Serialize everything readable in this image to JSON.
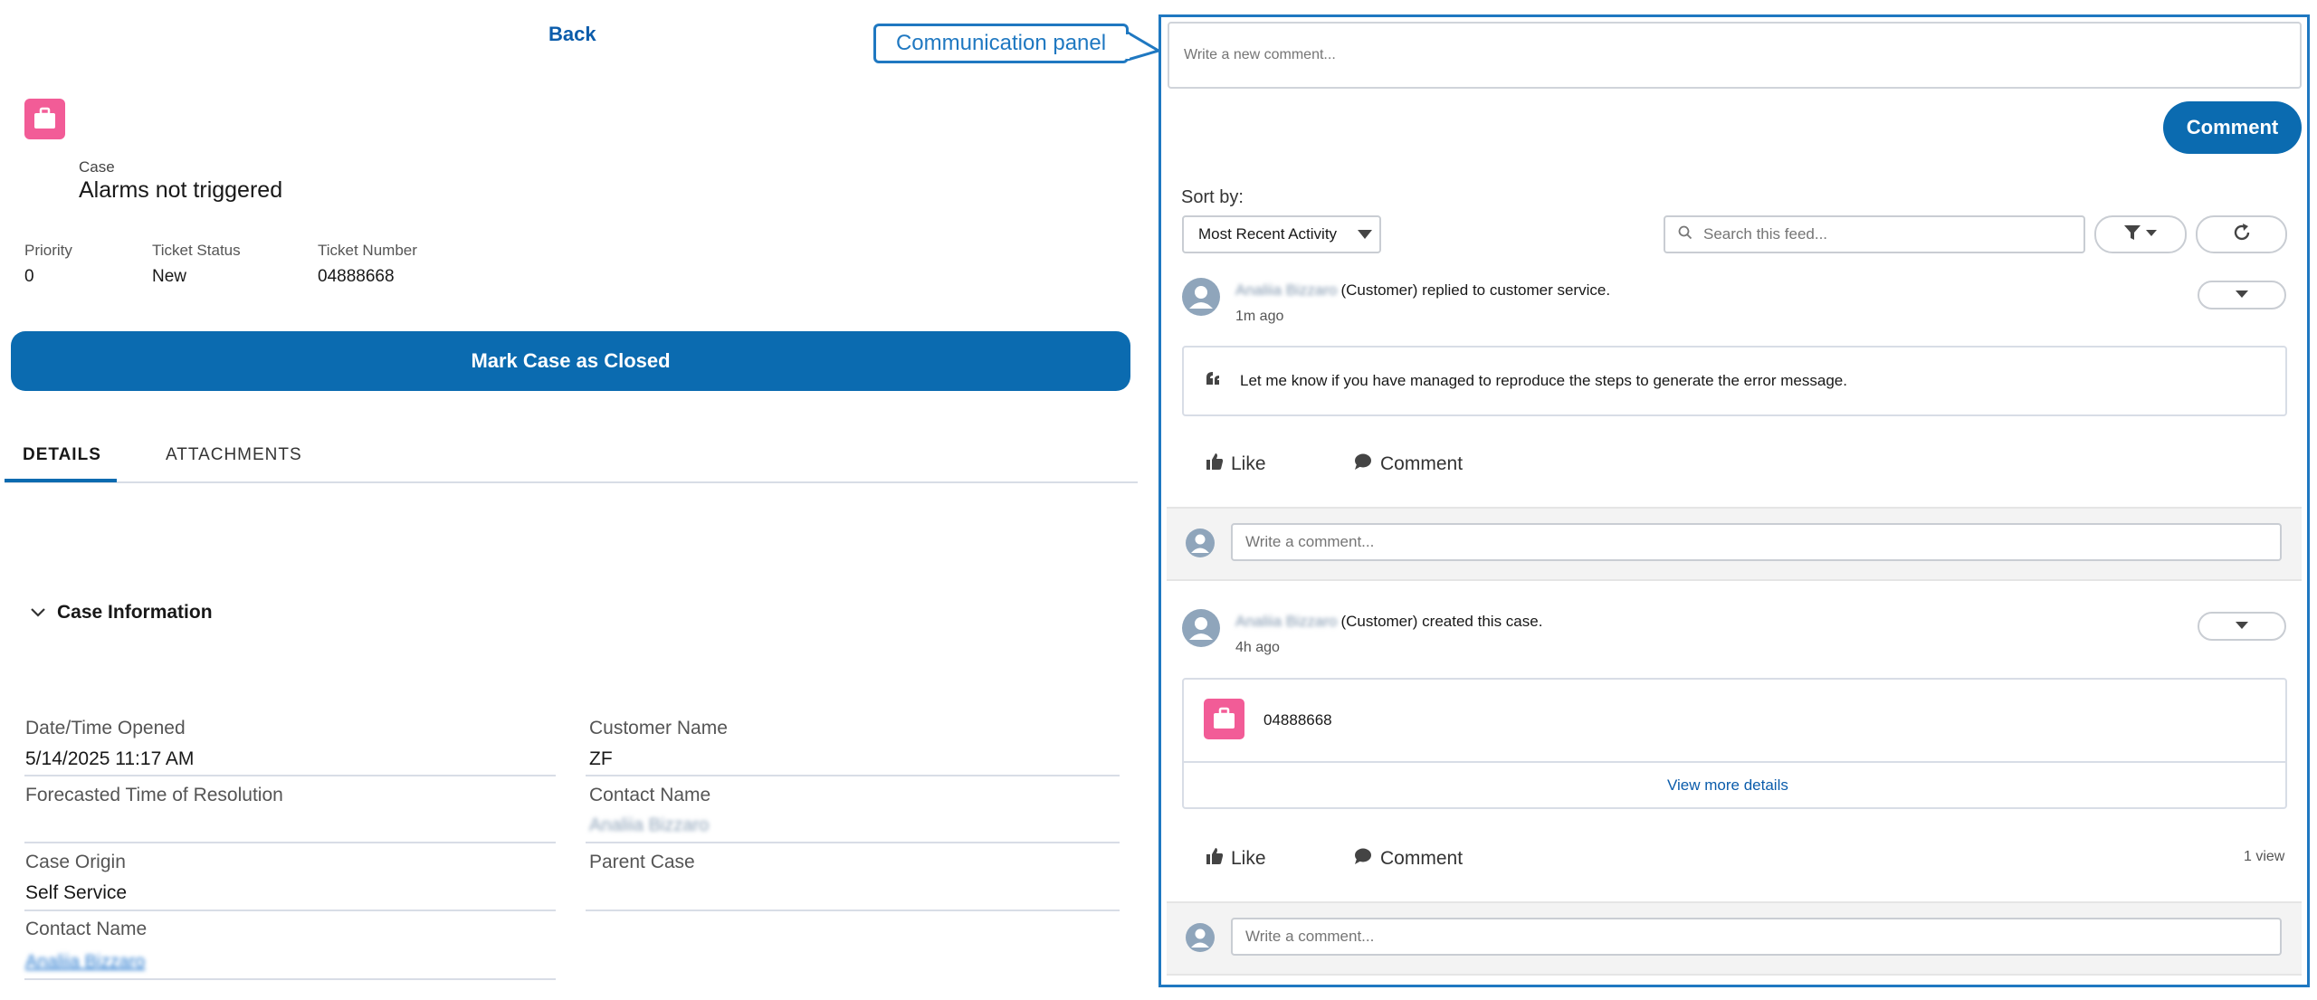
{
  "case": {
    "back_label": "Back",
    "object_label": "Case",
    "subject": "Alarms not triggered",
    "highlights": [
      {
        "label": "Priority",
        "value": "0"
      },
      {
        "label": "Ticket Status",
        "value": "New"
      },
      {
        "label": "Ticket Number",
        "value": "04888668"
      }
    ],
    "mark_closed_label": "Mark Case as Closed",
    "tabs": [
      "DETAILS",
      "ATTACHMENTS"
    ],
    "active_tab": "DETAILS",
    "section_title": "Case Information",
    "fields": {
      "date_opened_label": "Date/Time Opened",
      "date_opened_value": "5/14/2025 11:17 AM",
      "customer_name_label": "Customer Name",
      "customer_name_value": "ZF",
      "forecast_label": "Forecasted Time of Resolution",
      "forecast_value": "",
      "contact_name_label": "Contact Name",
      "contact_name_value": "Analiia Bizzaro",
      "case_origin_label": "Case Origin",
      "case_origin_value": "Self Service",
      "parent_case_label": "Parent Case",
      "parent_case_value": "",
      "contact_name2_label": "Contact Name",
      "contact_name2_value": "Analiia Bizzaro"
    },
    "colors": {
      "brand": "#0b6bb0",
      "case_icon": "#f25c97"
    }
  },
  "callout": {
    "label": "Communication panel",
    "color": "#1f78c1"
  },
  "feed": {
    "new_comment_placeholder": "Write a new comment...",
    "comment_button": "Comment",
    "sort_label": "Sort by:",
    "sort_value": "Most Recent Activity",
    "search_placeholder": "Search this feed...",
    "posts": [
      {
        "author": "Analiia Bizzaro",
        "action": "(Customer) replied to customer service.",
        "time": "1m ago",
        "body": "Let me know if you have managed to reproduce the steps to generate the error message.",
        "like_label": "Like",
        "comment_label": "Comment",
        "reply_placeholder": "Write a comment..."
      },
      {
        "author": "Analiia Bizzaro",
        "action": "(Customer) created this case.",
        "time": "4h ago",
        "case_number": "04888668",
        "view_more": "View more details",
        "like_label": "Like",
        "comment_label": "Comment",
        "views": "1 view",
        "reply_placeholder": "Write a comment..."
      }
    ],
    "icons": [
      "search-icon",
      "filter-icon",
      "refresh-icon",
      "chevron-down-icon",
      "like-icon",
      "comment-icon",
      "avatar-icon",
      "case-icon",
      "quote-icon"
    ]
  }
}
